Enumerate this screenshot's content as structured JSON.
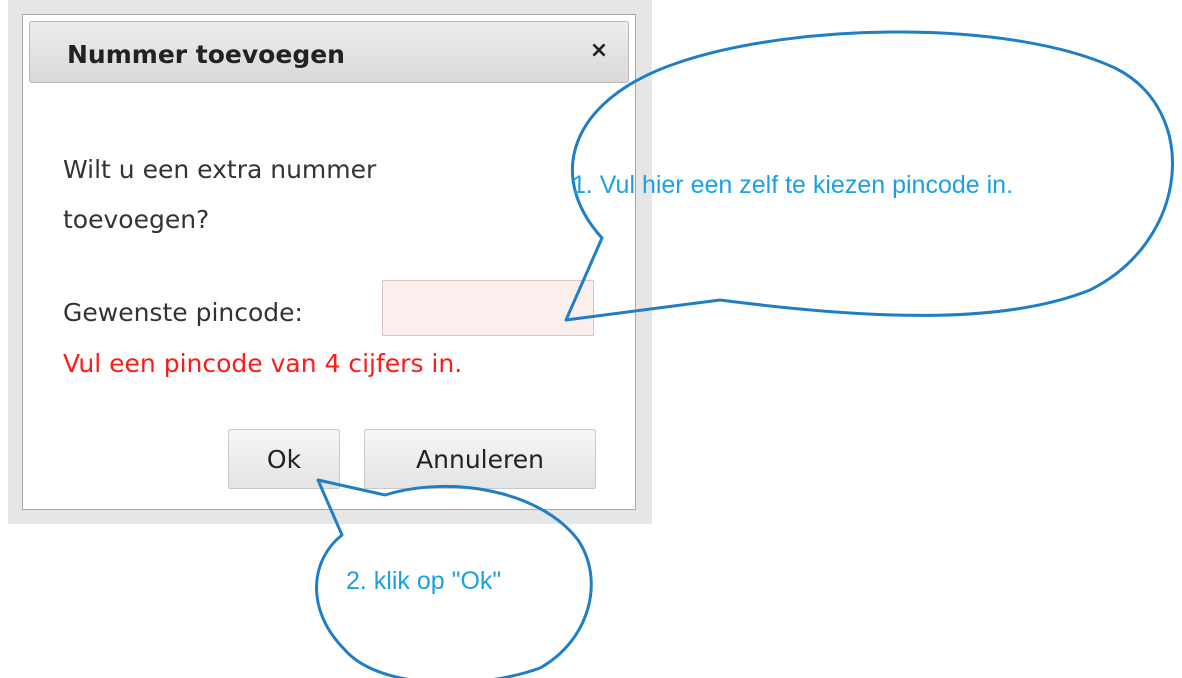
{
  "dialog": {
    "title": "Nummer toevoegen",
    "close_symbol": "×",
    "question": "Wilt u een extra nummer toevoegen?",
    "pin_label": "Gewenste pincode:",
    "pin_value": "",
    "error": "Vul een pincode van 4 cijfers in.",
    "ok_label": "Ok",
    "cancel_label": "Annuleren"
  },
  "callouts": {
    "step1": "1. Vul hier een zelf te kiezen pincode in.",
    "step2": "2. klik op \"Ok\""
  },
  "colors": {
    "callout": "#1ba1e2",
    "callout_outline": "#1f7ec6",
    "error": "#ff1a1a",
    "input_error_bg": "#fdeeee"
  },
  "icons": {
    "close": "close-icon"
  }
}
